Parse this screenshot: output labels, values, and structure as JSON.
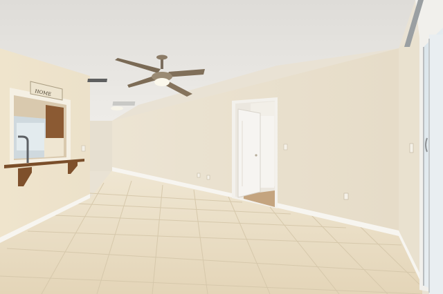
{
  "scene": {
    "kind": "empty-room-interior",
    "elements": [
      "textured-ceiling",
      "ceiling-fan",
      "tile-floor",
      "open-door",
      "pass-through-window",
      "sliding-glass-door"
    ]
  },
  "wall_sign": {
    "text": "HOME"
  },
  "palette": {
    "ceiling": "#e8e6e1",
    "wall": "#ece5d5",
    "wall_shadow": "#e2d9c6",
    "floor": "#e8dcc4",
    "grout": "#d3c4a6",
    "baseboard": "#f6f4ef",
    "wood": "#8a5a33",
    "door": "#f4f2ee"
  }
}
